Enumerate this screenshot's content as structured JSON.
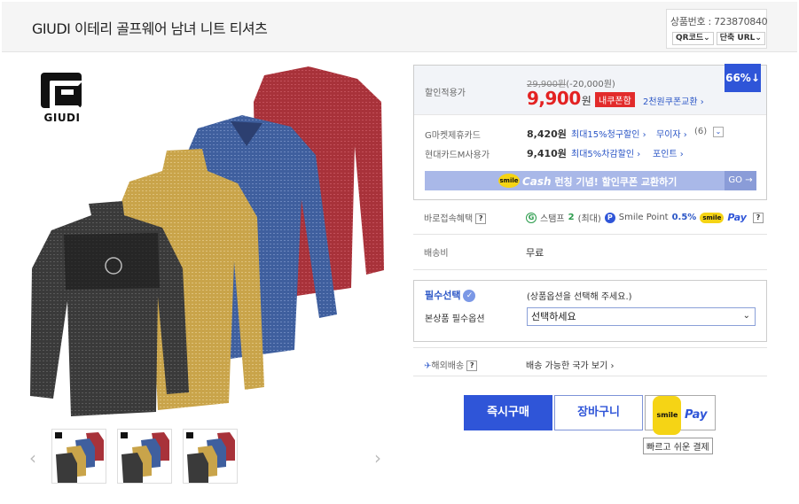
{
  "header": {
    "title": "GIUDI 이테리 골프웨어 남녀 니트 티셔츠",
    "product_number": "상품번호 : 723870840",
    "qr_label": "QR코드",
    "short_url_label": "단축 URL"
  },
  "brand": {
    "logo_text": "GIUDI"
  },
  "price": {
    "label": "할인적용가",
    "original": "29,900원",
    "discount": "(-20,000원)",
    "sale": "9,900",
    "sale_unit": "원",
    "inner_coupon_badge": "내쿠폰함",
    "coupon_exchange": "2천원쿠폰교환",
    "discount_percent": "66%"
  },
  "cards": [
    {
      "label": "G마켓제휴카드",
      "price": "8,420원",
      "benefit": "최대15%청구할인",
      "extra": "무이자",
      "count": "(6)"
    },
    {
      "label": "현대카드M사용가",
      "price": "9,410원",
      "benefit": "최대5%차감할인",
      "extra": "포인트",
      "count": ""
    }
  ],
  "cash_banner": {
    "logo": "smile",
    "cash": "Cash",
    "text": "런칭 기념! 할인쿠폰 교환하기",
    "go": "GO"
  },
  "benefits": {
    "label": "바로접속혜택",
    "stamp": "스탬프",
    "stamp_count": "2",
    "stamp_max": "(최대)",
    "smile_point": "Smile Point",
    "smile_point_pct": "0.5%",
    "pay": "Pay"
  },
  "shipping": {
    "label": "배송비",
    "value": "무료"
  },
  "option": {
    "title": "필수선택",
    "hint": "(상품옵션을 선택해 주세요.)",
    "field_label": "본상품 필수옵션",
    "selected": "선택하세요"
  },
  "overseas": {
    "label": "해외배송",
    "link": "배송 가능한 국가 보기"
  },
  "actions": {
    "buy": "즉시구매",
    "cart": "장바구니",
    "pay_smile": "smile",
    "pay_word": "Pay",
    "tooltip": "빠르고 쉬운 결제"
  },
  "colors": {
    "accent_blue": "#2f55d8",
    "sale_red": "#e32222",
    "link_blue": "#2b56c6"
  }
}
